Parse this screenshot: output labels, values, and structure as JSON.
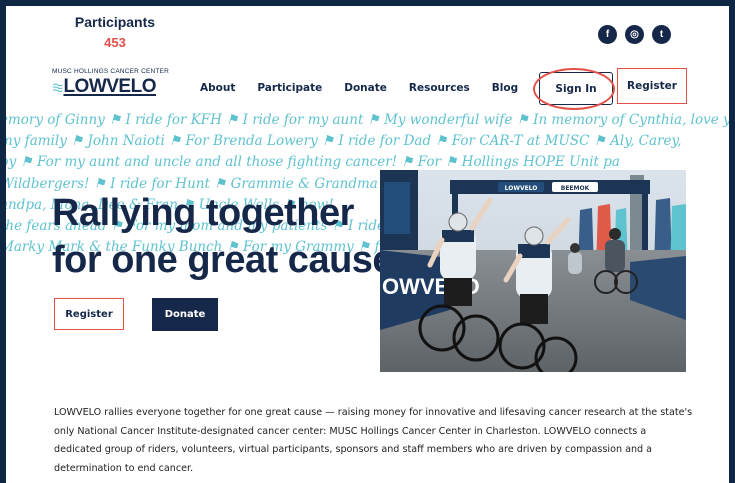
{
  "participants": {
    "label": "Participants",
    "count": "453"
  },
  "social": [
    {
      "icon": "facebook-icon",
      "glyph": "f"
    },
    {
      "icon": "instagram-icon",
      "glyph": "◎"
    },
    {
      "icon": "twitter-icon",
      "glyph": "t"
    }
  ],
  "logo": {
    "subtitle": "MUSC HOLLINGS CANCER CENTER",
    "name": "LOWVELO"
  },
  "nav": [
    {
      "label": "About"
    },
    {
      "label": "Participate"
    },
    {
      "label": "Donate"
    },
    {
      "label": "Resources"
    },
    {
      "label": "Blog"
    }
  ],
  "header_buttons": {
    "sign_in": "Sign In",
    "register": "Register"
  },
  "tribute_rows": [
    "emory of Ginny  ⚑  I ride for KFH  ⚑  I ride for my aunt  ⚑  My wonderful wife  ⚑  In memory of Cynthia, love y",
    "my family  ⚑  John Naioti  ⚑  For Brenda Lowery  ⚑  I ride for Dad  ⚑  For CAR-T at MUSC  ⚑  Aly, Carey,",
    "by  ⚑  For my aunt and uncle and all those fighting cancer!  ⚑  For  ⚑  Hollings HOPE Unit pa",
    "Wildbergers!  ⚑  I ride for Hunt  ⚑  Grammie & Grandma  ⚑  Moise",
    "andpa, Mona, Dee & Fran  ⚑  Uncle Wells  ⚑  now!",
    "the fears ahead  ⚑  For my mom and my patients  ⚑  I ride  ⚑  e lost th",
    "Marky Mark & the Funky Bunch  ⚑  For my Grammy  ⚑  for he"
  ],
  "hero": {
    "line1": "Rallying together",
    "line2": "for one great cause"
  },
  "hero_buttons": {
    "register": "Register",
    "donate": "Donate"
  },
  "photo": {
    "banner1": "LOWVELO",
    "banner2": "BEEMOK",
    "banner_left": "BEEMOK",
    "fence_text": "OWVELO"
  },
  "body": "LOWVELO rallies everyone together for one great cause — raising money for innovative and lifesaving cancer research at the state's only National Cancer Institute-designated cancer center: MUSC Hollings Cancer Center in Charleston. LOWVELO connects a dedicated group of riders, volunteers, virtual participants, sponsors and staff members who are driven by compassion and a determination to end cancer.",
  "colors": {
    "navy": "#16284a",
    "coral": "#e0524a",
    "teal": "#5fc2cf",
    "frame": "#0f2744"
  }
}
